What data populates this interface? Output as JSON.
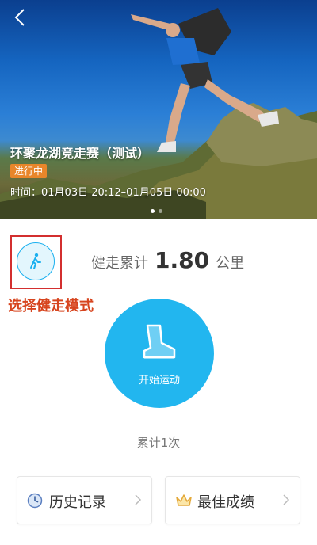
{
  "banner": {
    "title": "环聚龙湖竞走赛（测试）",
    "status": "进行中",
    "time": "时间：01月03日 20:12–01月05日 00:00",
    "carousel_total": 2,
    "carousel_active": 1
  },
  "mode": {
    "caption": "选择健走模式",
    "icon": "walking-icon"
  },
  "distance": {
    "label": "健走累计",
    "value": "1.80",
    "unit": "公里"
  },
  "start": {
    "label": "开始运动",
    "icon": "shoe-icon"
  },
  "total_count": "累计1次",
  "cards": {
    "history": {
      "label": "历史记录",
      "icon": "clock-icon"
    },
    "best": {
      "label": "最佳成绩",
      "icon": "crown-icon"
    }
  },
  "colors": {
    "accent": "#22b6ef",
    "badge": "#e8862a",
    "highlight": "#d32f2f"
  }
}
